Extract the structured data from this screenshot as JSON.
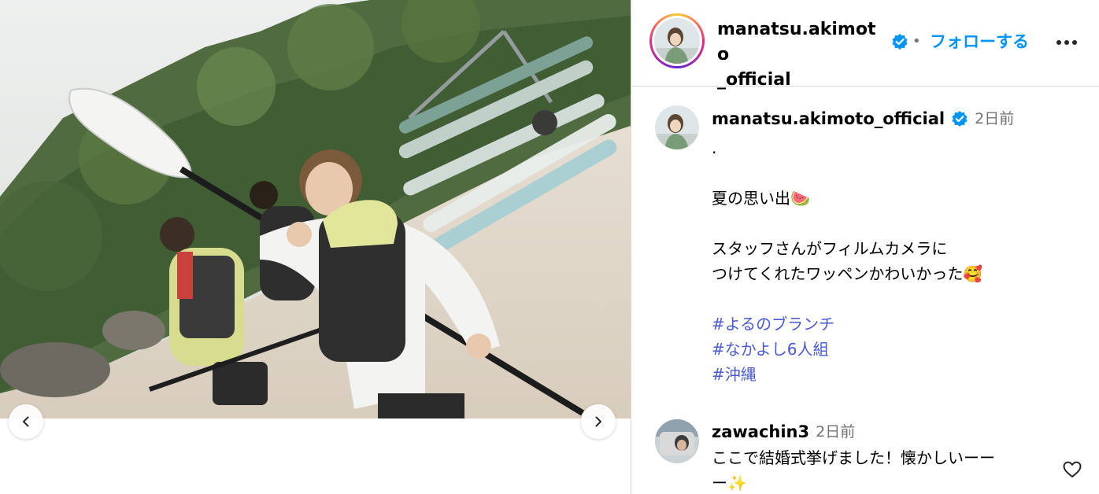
{
  "post": {
    "author": {
      "username": "manatsu.akimoto_official",
      "username_line1": "manatsu.akimoto",
      "username_line2": "_official",
      "verified": true
    },
    "header": {
      "separator": "•",
      "follow_label": "フォローする",
      "more_icon": "more-horizontal-icon"
    },
    "media": {
      "prev_icon": "chevron-left-icon",
      "next_icon": "chevron-right-icon"
    },
    "caption": {
      "username": "manatsu.akimoto_official",
      "time": "2日前",
      "lines": [
        ".",
        "",
        "夏の思い出🍉",
        "",
        "スタッフさんがフィルムカメラに",
        "つけてくれたワッペンかわいかった🥰",
        ""
      ],
      "hashtags": [
        "#よるのブランチ",
        "#なかよし6人組",
        "#沖縄"
      ]
    },
    "comments": [
      {
        "username": "zawachin3",
        "time": "2日前",
        "text_line1": "ここで結婚式挙げました！懐かしいーー",
        "text_line2": "ー✨",
        "like_icon": "heart-outline-icon"
      }
    ]
  },
  "colors": {
    "accent_blue": "#0095f6",
    "verified_blue": "#0095f6",
    "hashtag": "#4a5ad6",
    "muted": "#737373",
    "border": "#dbdbdb"
  }
}
